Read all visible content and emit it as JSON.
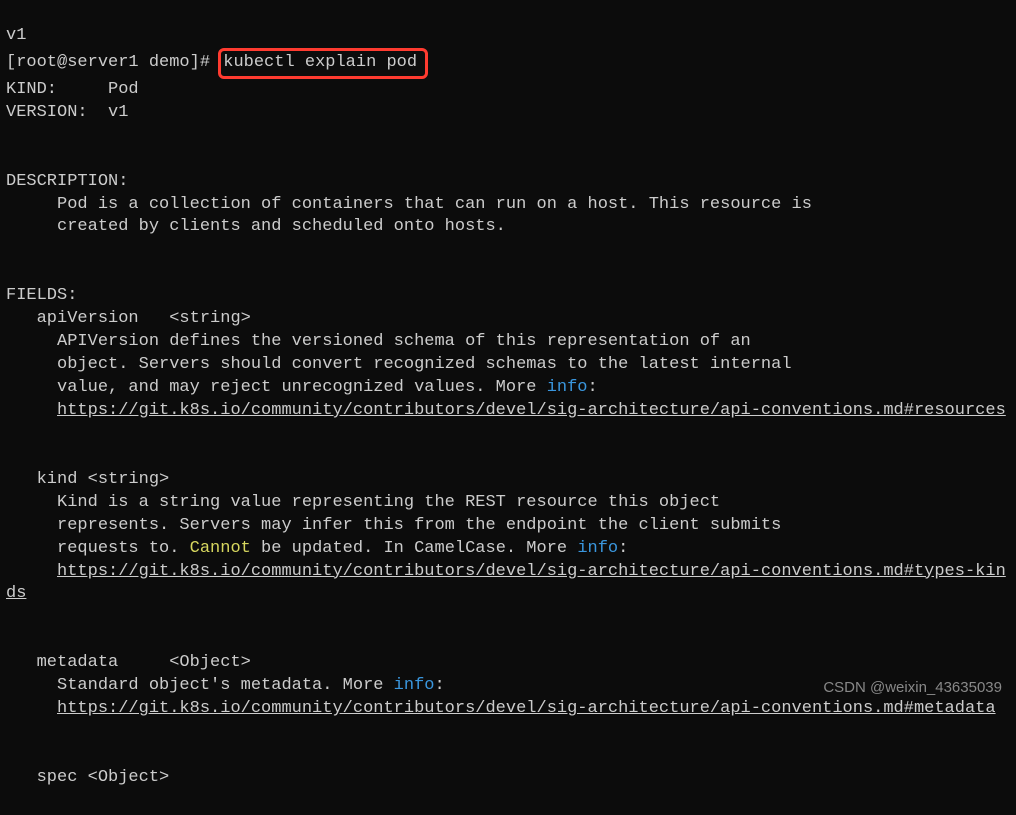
{
  "top_line": "v1",
  "prompt": "[root@server1 demo]# ",
  "command": "kubectl explain pod",
  "kind_label": "KIND:     ",
  "kind_value": "Pod",
  "version_label": "VERSION:  ",
  "version_value": "v1",
  "description_label": "DESCRIPTION:",
  "description_text1": "     Pod is a collection of containers that can run on a host. This resource is",
  "description_text2": "     created by clients and scheduled onto hosts.",
  "fields_label": "FIELDS:",
  "apiVersion_line": "   apiVersion   <string>",
  "apiVersion_desc1": "     APIVersion defines the versioned schema of this representation of an",
  "apiVersion_desc2": "     object. Servers should convert recognized schemas to the latest internal",
  "apiVersion_desc3_pre": "     value, and may reject unrecognized values. More ",
  "info_word": "info",
  "colon": ":",
  "url1_pre": "     ",
  "url1": "https://git.k8s.io/community/contributors/devel/sig-architecture/api-conventions.md#resources",
  "kind_line": "   kind <string>",
  "kind_desc1": "     Kind is a string value representing the REST resource this object",
  "kind_desc2": "     represents. Servers may infer this from the endpoint the client submits",
  "kind_desc3_pre": "     requests to. ",
  "cannot_word": "Cannot",
  "kind_desc3_post": " be updated. In CamelCase. More ",
  "url2": "https://git.k8s.io/community/contributors/devel/sig-architecture/api-conventions.md#types-kinds",
  "metadata_line": "   metadata     <Object>",
  "metadata_desc1_pre": "     Standard object's metadata. More ",
  "url3": "https://git.k8s.io/community/contributors/devel/sig-architecture/api-conventions.md#metadata",
  "spec_line": "   spec <Object>",
  "watermark": "CSDN @weixin_43635039"
}
